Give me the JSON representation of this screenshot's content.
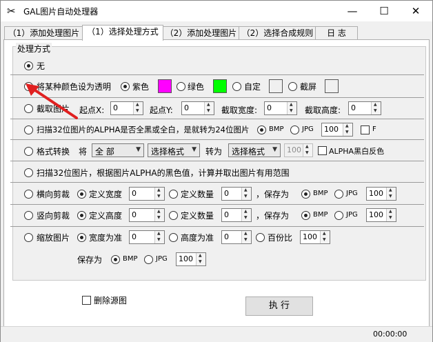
{
  "window": {
    "title": "GAL图片自动处理器",
    "app_icon": "scissors-icon",
    "minimize": "—",
    "maximize": "☐",
    "close": "✕"
  },
  "tabs": [
    {
      "label": "（1）添加处理图片"
    },
    {
      "label": "（1）选择处理方式"
    },
    {
      "label": "（2）添加处理图片"
    },
    {
      "label": "（2）选择合成规则"
    },
    {
      "label": "日 志"
    }
  ],
  "active_tab": 1,
  "group": {
    "legend": "处理方式"
  },
  "rows": {
    "none": {
      "label": "无",
      "selected": true
    },
    "transparent": {
      "label": "将某种颜色设为透明",
      "options": {
        "purple": "紫色",
        "green": "绿色",
        "custom": "自定",
        "screen": "截屏"
      },
      "colors": {
        "purple": "#ff00ff",
        "green": "#00ff00",
        "custom": "#f0f0f0",
        "screen": "#f0f0f0"
      }
    },
    "crop": {
      "label": "截取图片",
      "startx": "起点X:",
      "starty": "起点Y:",
      "width": "截取宽度:",
      "height": "截取高度:",
      "v1": "0",
      "v2": "0",
      "v3": "0",
      "v4": "0"
    },
    "alpha24": {
      "label": "扫描32位图片的ALPHA是否全黑或全白，是就转为24位图片",
      "bmp": "BMP",
      "jpg": "JPG",
      "quality": "100",
      "f": "F"
    },
    "format": {
      "label": "格式转换",
      "from_label": "将",
      "from_value": "全 部",
      "fmt1": "选择格式",
      "to_label": "转为",
      "fmt2": "选择格式",
      "quality": "100",
      "invert": "ALPHA黑白反色"
    },
    "scan": {
      "label": "扫描32位图片，根据图片ALPHA的黑色值，计算并取出图片有用范围"
    },
    "hcut": {
      "label": "横向剪裁",
      "opt1": "定义宽度",
      "v1": "0",
      "opt2": "定义数量",
      "v2": "0",
      "save": "，保存为",
      "bmp": "BMP",
      "jpg": "JPG",
      "q": "100"
    },
    "vcut": {
      "label": "竖向剪裁",
      "opt1": "定义高度",
      "v1": "0",
      "opt2": "定义数量",
      "v2": "0",
      "save": "，保存为",
      "bmp": "BMP",
      "jpg": "JPG",
      "q": "100"
    },
    "scale": {
      "label": "缩放图片",
      "opt1": "宽度为准",
      "v1": "0",
      "opt2": "高度为准",
      "v2": "0",
      "opt3": "百份比",
      "v3": "100",
      "save": "保存为",
      "bmp": "BMP",
      "jpg": "JPG",
      "q": "100"
    }
  },
  "delete_source": "删除源图",
  "execute": "执 行",
  "status_time": "00:00:00"
}
